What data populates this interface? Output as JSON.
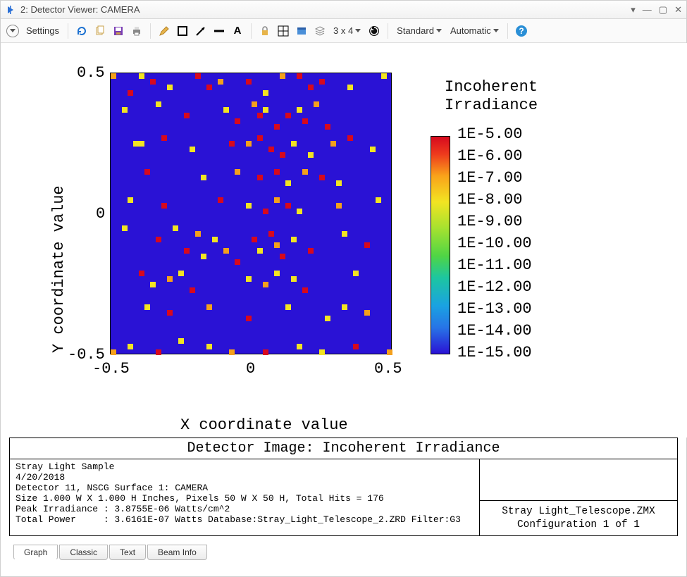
{
  "window": {
    "title": "2: Detector Viewer: CAMERA"
  },
  "toolbar": {
    "settings": "Settings",
    "grid_label": "3 x 4",
    "mode1": "Standard",
    "mode2": "Automatic"
  },
  "chart_data": {
    "type": "heatmap",
    "title": "Incoherent Irradiance",
    "xlabel": "X coordinate value",
    "ylabel": "Y coordinate value",
    "xlim": [
      -0.5,
      0.5
    ],
    "ylim": [
      -0.5,
      0.5
    ],
    "xticks": [
      -0.5,
      0,
      0.5
    ],
    "yticks": [
      -0.5,
      0,
      0.5
    ],
    "grid_resolution": [
      50,
      50
    ],
    "background_value": 1e-15,
    "colorbar": {
      "scale": "log",
      "labels": [
        "1E-5.00",
        "1E-6.00",
        "1E-7.00",
        "1E-8.00",
        "1E-9.00",
        "1E-10.00",
        "1E-11.00",
        "1E-12.00",
        "1E-13.00",
        "1E-14.00",
        "1E-15.00"
      ],
      "min": 1e-15,
      "max": 1e-05
    },
    "sparse_points_note": "Scattered bright pixels, approx col/row (0-49) and color class r=red(~1E-5..6), o=orange(~1E-7), y=yellow(~1E-8)",
    "sparse_points": [
      {
        "c": 0,
        "r": 0,
        "k": "o"
      },
      {
        "c": 3,
        "r": 3,
        "k": "r"
      },
      {
        "c": 5,
        "r": 0,
        "k": "y"
      },
      {
        "c": 7,
        "r": 1,
        "k": "r"
      },
      {
        "c": 10,
        "r": 2,
        "k": "y"
      },
      {
        "c": 15,
        "r": 0,
        "k": "r"
      },
      {
        "c": 17,
        "r": 2,
        "k": "r"
      },
      {
        "c": 19,
        "r": 1,
        "k": "o"
      },
      {
        "c": 24,
        "r": 1,
        "k": "r"
      },
      {
        "c": 27,
        "r": 3,
        "k": "y"
      },
      {
        "c": 30,
        "r": 0,
        "k": "o"
      },
      {
        "c": 33,
        "r": 0,
        "k": "r"
      },
      {
        "c": 35,
        "r": 2,
        "k": "r"
      },
      {
        "c": 37,
        "r": 1,
        "k": "r"
      },
      {
        "c": 42,
        "r": 2,
        "k": "y"
      },
      {
        "c": 48,
        "r": 0,
        "k": "y"
      },
      {
        "c": 2,
        "r": 6,
        "k": "y"
      },
      {
        "c": 8,
        "r": 5,
        "k": "y"
      },
      {
        "c": 13,
        "r": 7,
        "k": "r"
      },
      {
        "c": 20,
        "r": 6,
        "k": "y"
      },
      {
        "c": 22,
        "r": 8,
        "k": "r"
      },
      {
        "c": 25,
        "r": 5,
        "k": "o"
      },
      {
        "c": 26,
        "r": 7,
        "k": "r"
      },
      {
        "c": 27,
        "r": 6,
        "k": "y"
      },
      {
        "c": 29,
        "r": 9,
        "k": "r"
      },
      {
        "c": 31,
        "r": 7,
        "k": "r"
      },
      {
        "c": 33,
        "r": 6,
        "k": "y"
      },
      {
        "c": 34,
        "r": 8,
        "k": "r"
      },
      {
        "c": 36,
        "r": 5,
        "k": "o"
      },
      {
        "c": 38,
        "r": 9,
        "k": "r"
      },
      {
        "c": 4,
        "r": 12,
        "k": "y"
      },
      {
        "c": 5,
        "r": 12,
        "k": "y"
      },
      {
        "c": 9,
        "r": 11,
        "k": "r"
      },
      {
        "c": 14,
        "r": 13,
        "k": "y"
      },
      {
        "c": 21,
        "r": 12,
        "k": "r"
      },
      {
        "c": 24,
        "r": 12,
        "k": "o"
      },
      {
        "c": 26,
        "r": 11,
        "k": "r"
      },
      {
        "c": 28,
        "r": 13,
        "k": "r"
      },
      {
        "c": 30,
        "r": 14,
        "k": "r"
      },
      {
        "c": 32,
        "r": 12,
        "k": "y"
      },
      {
        "c": 35,
        "r": 14,
        "k": "y"
      },
      {
        "c": 39,
        "r": 12,
        "k": "o"
      },
      {
        "c": 42,
        "r": 11,
        "k": "r"
      },
      {
        "c": 46,
        "r": 13,
        "k": "y"
      },
      {
        "c": 6,
        "r": 17,
        "k": "r"
      },
      {
        "c": 16,
        "r": 18,
        "k": "y"
      },
      {
        "c": 22,
        "r": 17,
        "k": "o"
      },
      {
        "c": 26,
        "r": 18,
        "k": "r"
      },
      {
        "c": 29,
        "r": 17,
        "k": "r"
      },
      {
        "c": 31,
        "r": 19,
        "k": "y"
      },
      {
        "c": 34,
        "r": 17,
        "k": "o"
      },
      {
        "c": 37,
        "r": 18,
        "k": "r"
      },
      {
        "c": 40,
        "r": 19,
        "k": "y"
      },
      {
        "c": 3,
        "r": 22,
        "k": "y"
      },
      {
        "c": 9,
        "r": 23,
        "k": "r"
      },
      {
        "c": 19,
        "r": 22,
        "k": "r"
      },
      {
        "c": 24,
        "r": 23,
        "k": "y"
      },
      {
        "c": 27,
        "r": 24,
        "k": "r"
      },
      {
        "c": 29,
        "r": 22,
        "k": "o"
      },
      {
        "c": 31,
        "r": 23,
        "k": "r"
      },
      {
        "c": 33,
        "r": 24,
        "k": "y"
      },
      {
        "c": 40,
        "r": 23,
        "k": "o"
      },
      {
        "c": 47,
        "r": 22,
        "k": "y"
      },
      {
        "c": 2,
        "r": 27,
        "k": "y"
      },
      {
        "c": 8,
        "r": 29,
        "k": "r"
      },
      {
        "c": 11,
        "r": 27,
        "k": "y"
      },
      {
        "c": 13,
        "r": 31,
        "k": "r"
      },
      {
        "c": 15,
        "r": 28,
        "k": "o"
      },
      {
        "c": 16,
        "r": 32,
        "k": "y"
      },
      {
        "c": 18,
        "r": 29,
        "k": "y"
      },
      {
        "c": 20,
        "r": 31,
        "k": "o"
      },
      {
        "c": 22,
        "r": 33,
        "k": "r"
      },
      {
        "c": 25,
        "r": 29,
        "k": "r"
      },
      {
        "c": 26,
        "r": 31,
        "k": "y"
      },
      {
        "c": 28,
        "r": 28,
        "k": "r"
      },
      {
        "c": 29,
        "r": 30,
        "k": "o"
      },
      {
        "c": 30,
        "r": 32,
        "k": "r"
      },
      {
        "c": 32,
        "r": 29,
        "k": "y"
      },
      {
        "c": 35,
        "r": 31,
        "k": "r"
      },
      {
        "c": 41,
        "r": 28,
        "k": "y"
      },
      {
        "c": 45,
        "r": 30,
        "k": "r"
      },
      {
        "c": 5,
        "r": 35,
        "k": "r"
      },
      {
        "c": 7,
        "r": 37,
        "k": "y"
      },
      {
        "c": 10,
        "r": 36,
        "k": "o"
      },
      {
        "c": 12,
        "r": 35,
        "k": "y"
      },
      {
        "c": 14,
        "r": 38,
        "k": "r"
      },
      {
        "c": 24,
        "r": 36,
        "k": "y"
      },
      {
        "c": 27,
        "r": 37,
        "k": "o"
      },
      {
        "c": 29,
        "r": 35,
        "k": "y"
      },
      {
        "c": 32,
        "r": 36,
        "k": "y"
      },
      {
        "c": 34,
        "r": 38,
        "k": "r"
      },
      {
        "c": 43,
        "r": 35,
        "k": "y"
      },
      {
        "c": 6,
        "r": 41,
        "k": "y"
      },
      {
        "c": 10,
        "r": 42,
        "k": "r"
      },
      {
        "c": 17,
        "r": 41,
        "k": "o"
      },
      {
        "c": 24,
        "r": 43,
        "k": "r"
      },
      {
        "c": 31,
        "r": 41,
        "k": "y"
      },
      {
        "c": 38,
        "r": 43,
        "k": "y"
      },
      {
        "c": 41,
        "r": 41,
        "k": "y"
      },
      {
        "c": 45,
        "r": 42,
        "k": "o"
      },
      {
        "c": 0,
        "r": 49,
        "k": "o"
      },
      {
        "c": 3,
        "r": 48,
        "k": "y"
      },
      {
        "c": 8,
        "r": 49,
        "k": "r"
      },
      {
        "c": 12,
        "r": 47,
        "k": "y"
      },
      {
        "c": 17,
        "r": 48,
        "k": "y"
      },
      {
        "c": 21,
        "r": 49,
        "k": "o"
      },
      {
        "c": 27,
        "r": 49,
        "k": "r"
      },
      {
        "c": 33,
        "r": 48,
        "k": "y"
      },
      {
        "c": 37,
        "r": 49,
        "k": "y"
      },
      {
        "c": 43,
        "r": 48,
        "k": "r"
      },
      {
        "c": 49,
        "r": 49,
        "k": "o"
      }
    ]
  },
  "info": {
    "title": "Detector Image: Incoherent Irradiance",
    "body": "Stray Light Sample\n4/20/2018\nDetector 11, NSCG Surface 1: CAMERA\nSize 1.000 W X 1.000 H Inches, Pixels 50 W X 50 H, Total Hits = 176\nPeak Irradiance : 3.8755E-06 Watts/cm^2\nTotal Power     : 3.6161E-07 Watts Database:Stray_Light_Telescope_2.ZRD Filter:G3",
    "right1": "Stray Light_Telescope.ZMX",
    "right2": "Configuration 1 of 1"
  },
  "tabs": {
    "items": [
      "Graph",
      "Classic",
      "Text",
      "Beam Info"
    ],
    "active": 0
  }
}
